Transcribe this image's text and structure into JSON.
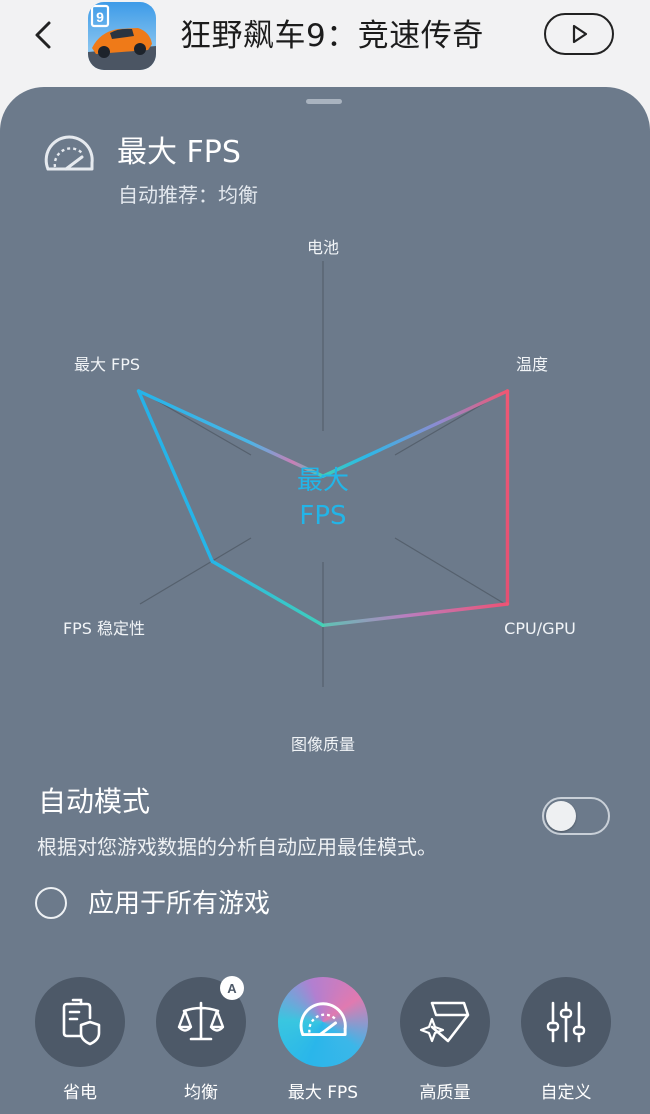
{
  "header": {
    "app_title": "狂野飙车9：竞速传奇",
    "back_icon": "chevron-left-icon",
    "play_icon": "play-icon"
  },
  "panel": {
    "mode_title": "最大 FPS",
    "mode_subtitle": "自动推荐：均衡",
    "mode_icon": "speedometer-icon"
  },
  "chart_data": {
    "type": "radar",
    "axes": [
      "电池",
      "温度",
      "CPU/GPU",
      "图像质量",
      "FPS 稳定性",
      "最大 FPS"
    ],
    "values": [
      0.1,
      1.0,
      1.0,
      0.6,
      0.6,
      1.0
    ],
    "center_label": [
      "最大",
      "FPS"
    ],
    "colors": {
      "cyan": "#22b5e8",
      "teal": "#3fd0b6",
      "pink": "#ec5a7a",
      "purple": "#b77bd3"
    }
  },
  "auto_mode": {
    "title": "自动模式",
    "description": "根据对您游戏数据的分析自动应用最佳模式。",
    "toggle_on": false
  },
  "apply_all": {
    "label": "应用于所有游戏",
    "checked": false
  },
  "modes": [
    {
      "label": "省电",
      "icon": "battery-shield-icon",
      "active": false
    },
    {
      "label": "均衡",
      "icon": "balance-scale-icon",
      "active": false,
      "badge": "A"
    },
    {
      "label": "最大 FPS",
      "icon": "speedometer-icon",
      "active": true
    },
    {
      "label": "高质量",
      "icon": "diamond-sparkle-icon",
      "active": false
    },
    {
      "label": "自定义",
      "icon": "sliders-icon",
      "active": false
    }
  ]
}
